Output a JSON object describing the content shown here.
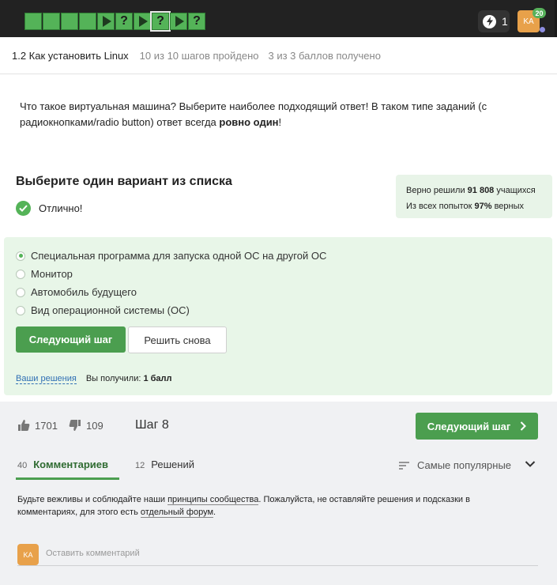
{
  "topbar": {
    "steps": [
      {
        "type": "solved"
      },
      {
        "type": "solved"
      },
      {
        "type": "solved"
      },
      {
        "type": "solved"
      },
      {
        "type": "play"
      },
      {
        "type": "question"
      },
      {
        "type": "play"
      },
      {
        "type": "question",
        "active": true
      },
      {
        "type": "play"
      },
      {
        "type": "question"
      }
    ],
    "step_question_glyph": "?",
    "energy_count": "1",
    "avatar_initials": "KA",
    "notifications_badge": "20"
  },
  "lesson": {
    "title": "1.2 Как установить Linux",
    "steps_progress": "10 из 10 шагов пройдено",
    "score_progress": "3 из 3 баллов  получено"
  },
  "question": {
    "text_part1": "Что такое виртуальная машина? Выберите наиболее подходящий ответ! В таком типе заданий (с радиокнопками/radio button) ответ всегда ",
    "text_bold": "ровно один",
    "text_part2": "!"
  },
  "task": {
    "title": "Выберите один вариант из списка",
    "result_text": "Отлично!"
  },
  "stats": {
    "solved_prefix": "Верно решили ",
    "solved_count": "91 808",
    "solved_suffix": " учащихся",
    "attempts_prefix": "Из всех попыток ",
    "attempts_percent": "97%",
    "attempts_suffix": " верных"
  },
  "options": [
    {
      "label": "Специальная программа для запуска одной ОС на другой ОС",
      "selected": true
    },
    {
      "label": "Монитор",
      "selected": false
    },
    {
      "label": "Автомобиль будущего",
      "selected": false
    },
    {
      "label": "Вид операционной системы (ОС)",
      "selected": false
    }
  ],
  "buttons": {
    "next_step": "Следующий шаг",
    "retry": "Решить снова"
  },
  "solutions": {
    "link": "Ваши решения",
    "received_prefix": "Вы получили: ",
    "received_value": "1 балл"
  },
  "footer": {
    "likes": "1701",
    "dislikes": "109",
    "step_label": "Шаг 8",
    "next_step": "Следующий шаг",
    "tabs": [
      {
        "count": "40",
        "label": "Комментариев",
        "active": true
      },
      {
        "count": "12",
        "label": "Решений",
        "active": false
      }
    ],
    "sort_label": "Самые популярные",
    "notice_part1": "Будьте вежливы и соблюдайте наши ",
    "notice_link1": "принципы сообщества",
    "notice_part2": ". Пожалуйста, не оставляйте решения и подсказки в комментариях, для этого есть ",
    "notice_link2": "отдельный форум",
    "notice_part3": ".",
    "avatar_initials": "KA",
    "comment_placeholder": "Оставить комментарий"
  },
  "colors": {
    "accent_green": "#4b9e4f",
    "step_green": "#54b358",
    "topbar_bg": "#222222",
    "panel_green": "#e8f6e8",
    "avatar_orange": "#e8a14a",
    "link_blue": "#2f6fb4"
  },
  "icons": {
    "energy": "lightning-icon",
    "check": "checkmark-icon",
    "like": "thumbs-up-icon",
    "dislike": "thumbs-down-icon",
    "next": "chevron-right-icon",
    "sort": "sort-lines-icon",
    "expand": "chevron-down-icon"
  }
}
